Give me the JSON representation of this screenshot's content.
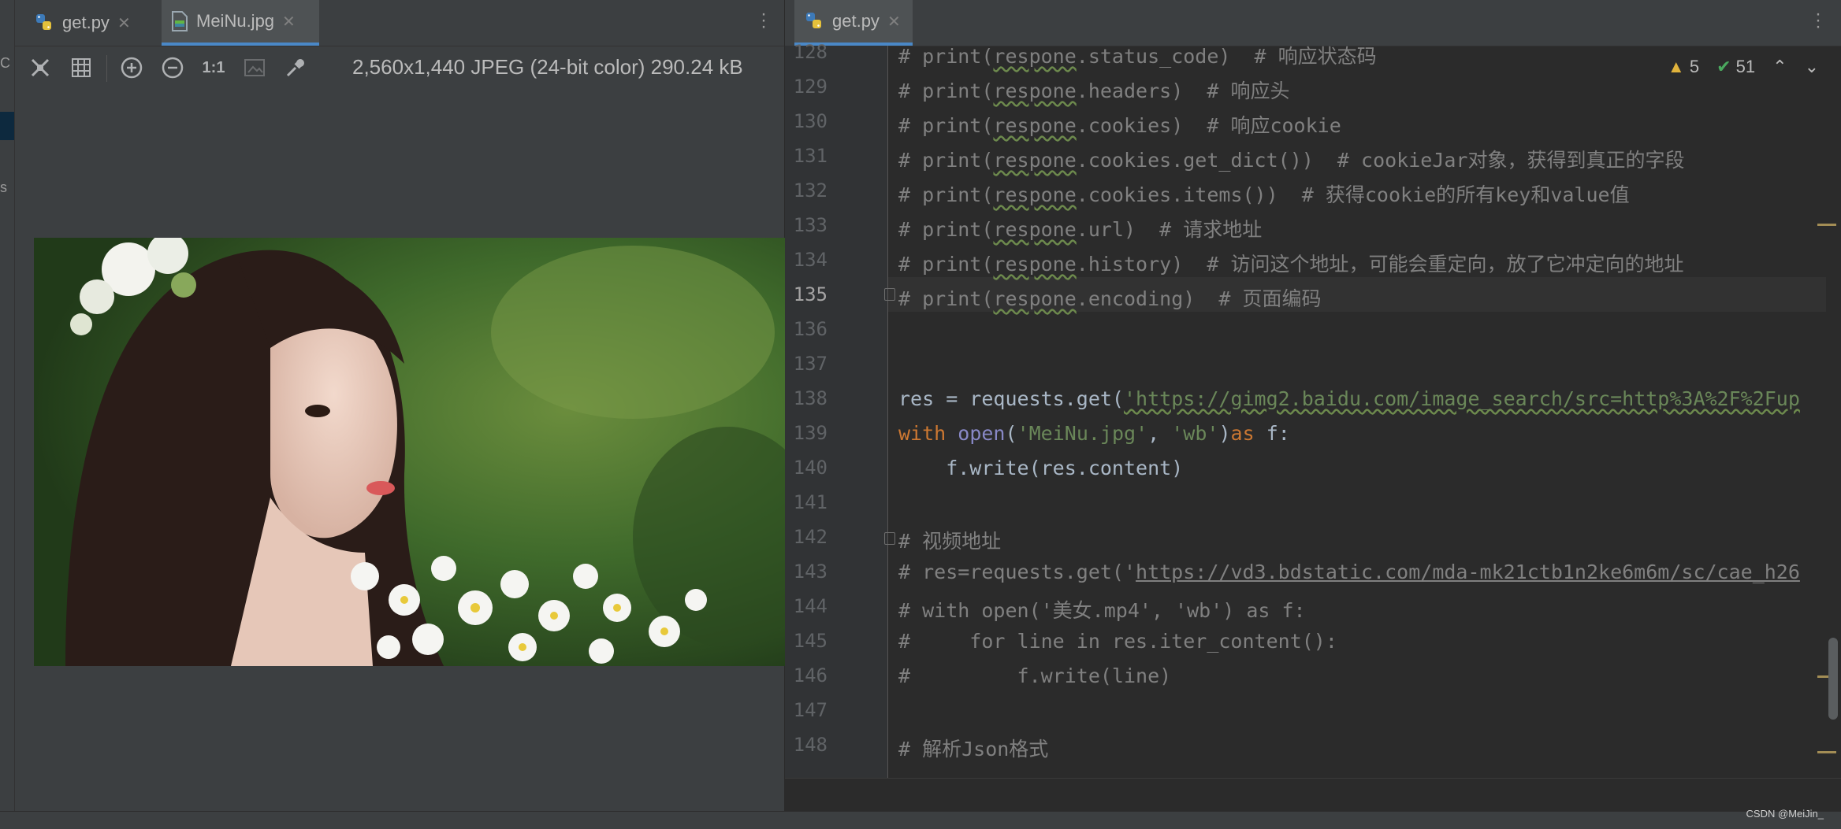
{
  "left_strip": {
    "top_char": "C",
    "mid_char": "s"
  },
  "left_tabs": [
    {
      "label": "get.py",
      "icon": "python-file-icon",
      "active": false
    },
    {
      "label": "MeiNu.jpg",
      "icon": "image-file-icon",
      "active": true
    }
  ],
  "right_tabs": [
    {
      "label": "get.py",
      "icon": "python-file-icon",
      "active": true
    }
  ],
  "viewer": {
    "zoom_actual_label": "1:1",
    "image_info": "2,560x1,440 JPEG (24-bit color) 290.24 kB"
  },
  "inspections": {
    "warnings": "5",
    "ok_count": "51"
  },
  "editor": {
    "current_line": "135",
    "lines": [
      {
        "n": "128",
        "text": "# print(respone.status_code)  # 响应状态码"
      },
      {
        "n": "129",
        "text": "# print(respone.headers)  # 响应头"
      },
      {
        "n": "130",
        "text": "# print(respone.cookies)  # 响应cookie"
      },
      {
        "n": "131",
        "text": "# print(respone.cookies.get_dict())  # cookieJar对象，获得到真正的字段"
      },
      {
        "n": "132",
        "text": "# print(respone.cookies.items())  # 获得cookie的所有key和value值"
      },
      {
        "n": "133",
        "text": "# print(respone.url)  # 请求地址"
      },
      {
        "n": "134",
        "text": "# print(respone.history)  # 访问这个地址，可能会重定向，放了它冲定向的地址"
      },
      {
        "n": "135",
        "text": "# print(respone.encoding)  # 页面编码"
      },
      {
        "n": "136",
        "text": ""
      },
      {
        "n": "137",
        "text": ""
      },
      {
        "n": "138",
        "text": "res = requests.get('https://gimg2.baidu.com/image_search/src=http%3A%2F%2Fup"
      },
      {
        "n": "139",
        "text": "with open('MeiNu.jpg', 'wb')as f:"
      },
      {
        "n": "140",
        "text": "    f.write(res.content)"
      },
      {
        "n": "141",
        "text": ""
      },
      {
        "n": "142",
        "text": "# 视频地址"
      },
      {
        "n": "143",
        "text": "# res=requests.get('https://vd3.bdstatic.com/mda-mk21ctb1n2ke6m6m/sc/cae_h26"
      },
      {
        "n": "144",
        "text": "# with open('美女.mp4', 'wb') as f:"
      },
      {
        "n": "145",
        "text": "#     for line in res.iter_content():"
      },
      {
        "n": "146",
        "text": "#         f.write(line)"
      },
      {
        "n": "147",
        "text": ""
      },
      {
        "n": "148",
        "text": "# 解析Json格式"
      }
    ],
    "tokens": {
      "l128_pre": "# print(",
      "l128_word": "respone",
      "l128_post": ".status_code)  # 响应状态码",
      "l129_pre": "# print(",
      "l129_word": "respone",
      "l129_post": ".headers)  # 响应头",
      "l130_pre": "# print(",
      "l130_word": "respone",
      "l130_post": ".cookies)  # 响应cookie",
      "l131_pre": "# print(",
      "l131_word": "respone",
      "l131_post": ".cookies.get_dict())  # cookieJar对象，获得到真正的字段",
      "l132_pre": "# print(",
      "l132_word": "respone",
      "l132_post": ".cookies.items())  # 获得cookie的所有key和value值",
      "l133_pre": "# print(",
      "l133_word": "respone",
      "l133_post": ".url)  # 请求地址",
      "l134_pre": "# print(",
      "l134_word": "respone",
      "l134_post": ".history)  # 访问这个地址，可能会重定向，放了它冲定向的地址",
      "l135_pre": "# print(",
      "l135_word": "respone",
      "l135_post": ".encoding)  # 页面编码",
      "l138_a": "res = requests.get(",
      "l138_url": "'https://gimg2.baidu.com/image_search/src=http%3A%2F%2Fup",
      "l139_with": "with",
      "l139_open": "open",
      "l139_p1": "(",
      "l139_s1": "'MeiNu.jpg'",
      "l139_c": ", ",
      "l139_s2": "'wb'",
      "l139_p2": ")",
      "l139_as": "as",
      "l139_f": " f:",
      "l140": "    f.write(res.content)",
      "l142": "# 视频地址",
      "l143_a": "# res=requests.get('",
      "l143_url": "https://vd3.bdstatic.com/mda-mk21ctb1n2ke6m6m/sc/cae_h26",
      "l144": "# with open('美女.mp4', 'wb') as f:",
      "l145": "#     for line in res.iter_content():",
      "l146": "#         f.write(line)",
      "l148": "# 解析Json格式"
    }
  },
  "watermark": "CSDN @MeiJin_"
}
